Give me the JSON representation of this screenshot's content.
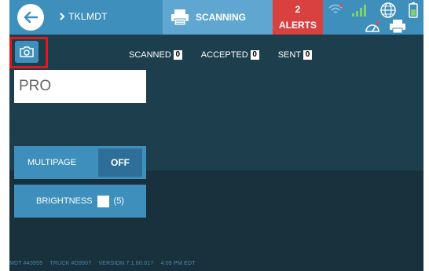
{
  "header": {
    "breadcrumb": "TKLMDT",
    "scanning_tab": "SCANNING",
    "alerts": {
      "count": "2",
      "label": "ALERTS"
    }
  },
  "status_icons": [
    "wifi-icon",
    "signal-bars-icon",
    "globe-icon",
    "battery-icon",
    "gauge-icon",
    "printer-icon"
  ],
  "counters": {
    "scanned": {
      "label": "SCANNED",
      "value": "0"
    },
    "accepted": {
      "label": "ACCEPTED",
      "value": "0"
    },
    "sent": {
      "label": "SENT",
      "value": "0"
    }
  },
  "pro_field": {
    "placeholder": "PRO"
  },
  "multipage": {
    "label": "MULTIPAGE",
    "state": "OFF"
  },
  "brightness": {
    "label": "BRIGHTNESS",
    "value": "(5)"
  },
  "footer": {
    "mdt": "MDT #43955",
    "truck": "TRUCK #D9907",
    "version": "VERSION  7.1.60.017",
    "time": "4:09 PM EDT"
  },
  "colors": {
    "topbar": "#3f8fbd",
    "scanning_tab": "#5fa6d0",
    "alerts": "#d94040",
    "background": "#1d3e4d",
    "highlight": "#e01919"
  }
}
